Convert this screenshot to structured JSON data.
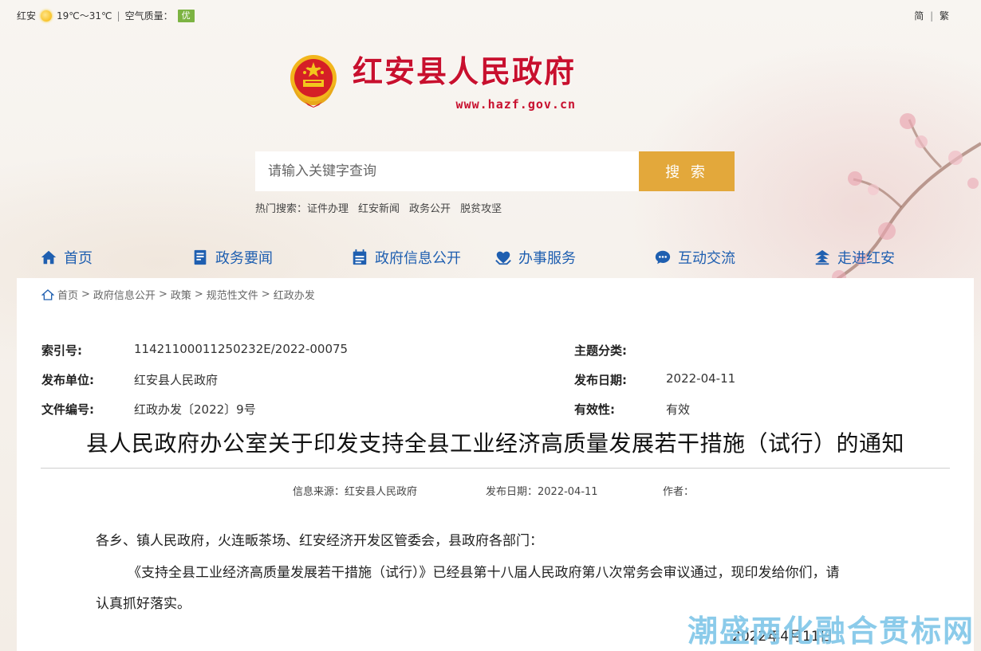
{
  "topbar": {
    "location": "红安",
    "temperature": "19℃～31℃",
    "separator": "|",
    "aq_label": "空气质量：",
    "aq_value": "优",
    "lang_simplified": "简",
    "lang_sep": "|",
    "lang_traditional": "繁"
  },
  "logo": {
    "title": "红安县人民政府",
    "url": "www.hazf.gov.cn"
  },
  "search": {
    "placeholder": "请输入关键字查询",
    "button_label": "搜 索"
  },
  "hot_search": {
    "label": "热门搜索：",
    "items": [
      "证件办理",
      "红安新闻",
      "政务公开",
      "脱贫攻坚"
    ]
  },
  "nav": {
    "items": [
      {
        "label": "首页",
        "icon": "home-icon"
      },
      {
        "label": "政务要闻",
        "icon": "news-icon"
      },
      {
        "label": "政府信息公开",
        "icon": "calendar-icon"
      },
      {
        "label": "办事服务",
        "icon": "service-icon"
      },
      {
        "label": "互动交流",
        "icon": "chat-icon"
      },
      {
        "label": "走进红安",
        "icon": "landmark-icon"
      }
    ]
  },
  "breadcrumb": {
    "items": [
      "首页",
      "政府信息公开",
      "政策",
      "规范性文件",
      "红政办发"
    ],
    "sep": ">"
  },
  "meta": {
    "index_label": "索引号:",
    "index_value": "11421100011250232E/2022-00075",
    "topic_label": "主题分类:",
    "topic_value": "",
    "publisher_label": "发布单位:",
    "publisher_value": "红安县人民政府",
    "date_label": "发布日期:",
    "date_value": "2022-04-11",
    "docno_label": "文件编号:",
    "docno_value": "红政办发〔2022〕9号",
    "validity_label": "有效性:",
    "validity_value": "有效"
  },
  "document": {
    "title": "县人民政府办公室关于印发支持全县工业经济高质量发展若干措施（试行）的通知",
    "source": "信息来源：红安县人民政府",
    "publish_date": "发布日期：2022-04-11",
    "author": "作者：",
    "salutation": "各乡、镇人民政府，火连畈茶场、红安经济开发区管委会，县政府各部门：",
    "paragraph_line1": "《支持全县工业经济高质量发展若干措施（试行）》已经县第十八届人民政府第八次常务会审议通过，现印发给你们，请",
    "paragraph_line2": "认真抓好落实。",
    "sign_date": "2022年4月11日"
  },
  "watermark": "潮盛两化融合贯标网",
  "colors": {
    "brand_red": "#c8102e",
    "nav_blue": "#1f5fb0",
    "search_button": "#e3a83b",
    "aq_green": "#7cb342"
  }
}
